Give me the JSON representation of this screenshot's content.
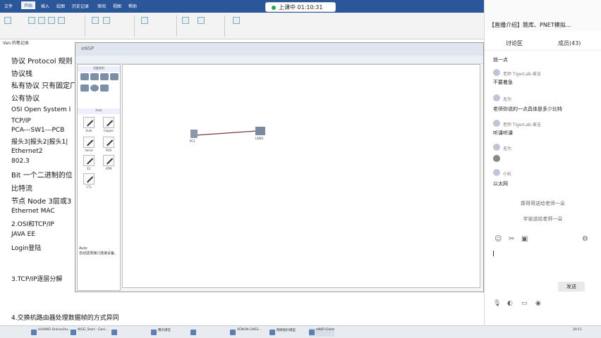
{
  "ribbon": {
    "tabs": [
      "文件",
      "开始",
      "插入",
      "绘图",
      "历史记录",
      "审阅",
      "视图",
      "帮助"
    ],
    "active_tab": "开始"
  },
  "doc_tab": "Van 的笔记本",
  "notes": [
    "协议 Protocol 规则",
    "协议栈",
    "私有协议 只有固定厂",
    "公有协议",
    "OSI Open System I",
    "TCP/IP",
    "PCA---SW1---PCB",
    "报头3|报头2|报头1|",
    "Ethernet2",
    "802.3",
    "Bit 一个二进制的位",
    "比特流",
    "节点 Node 3层或3",
    "Ethernet MAC",
    "2.OSI和TCP/IP",
    "JAVA EE",
    "Login登陆",
    "3.TCP/IP逐层分解",
    "4.交换机路由器处理数据帧的方式异同"
  ],
  "ensp": {
    "title": "eNSP",
    "palette_header": "设备类别",
    "auto_header": "Auto",
    "cables": [
      {
        "label": "Auto"
      },
      {
        "label": "Copper"
      },
      {
        "label": "Serial"
      },
      {
        "label": "POS"
      },
      {
        "label": "E1"
      },
      {
        "label": "ATM"
      },
      {
        "label": "CTL"
      }
    ],
    "info_title": "Auto",
    "info_text": "自动选择接口连接设备。",
    "devices": [
      {
        "label": "PC1"
      },
      {
        "label": "LSW1"
      }
    ]
  },
  "recording": {
    "text": "上课中 01:10:31"
  },
  "chat": {
    "title": "【直播介绍】题库、PNET模拟...",
    "tabs": [
      "讨论区",
      "成员(43)"
    ],
    "messages": [
      {
        "name": "",
        "text": "就一点"
      },
      {
        "name": "老师 TigerLab-爱吉",
        "text": "不要着急"
      },
      {
        "name": "无为",
        "text": "老师你说的一点具体是多少比特"
      },
      {
        "name": "老师 TigerLab-爱吉",
        "text": "听课听课"
      },
      {
        "name": "无为",
        "text": ""
      },
      {
        "name": "小杭",
        "text": "以太网"
      }
    ],
    "system_msgs": [
      "霖哥哥送给老师一朵",
      "宇宙送给老师一朵"
    ],
    "send_label": "发送"
  },
  "taskbar": {
    "items": [
      "HUAWEI Online(Hu...",
      "WGG_Start - Geni...",
      "",
      "腾讯课堂",
      "",
      "XENON-GNS3...",
      "网络拓扑模型",
      "eNSP Client"
    ],
    "clock": "20:11"
  }
}
